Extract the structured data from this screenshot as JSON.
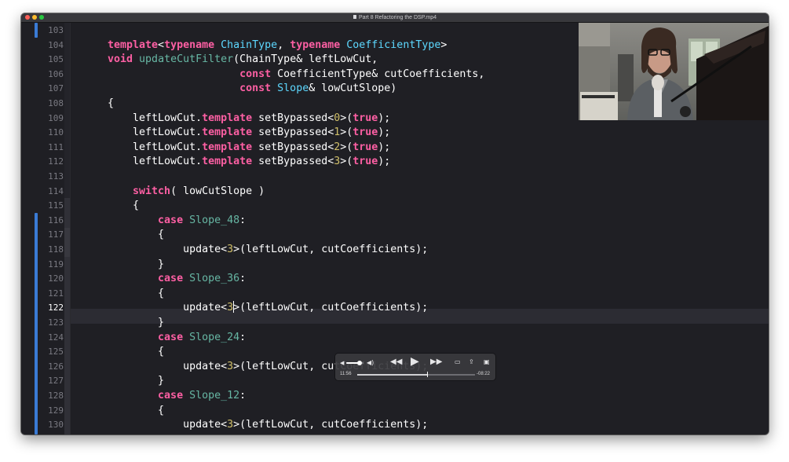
{
  "window": {
    "title": "Part 8 Refactoring the DSP.mp4"
  },
  "editor": {
    "current_line": 122,
    "lines": [
      {
        "num": "103",
        "tokens": []
      },
      {
        "num": "104",
        "tokens": [
          {
            "c": "kw",
            "t": "template"
          },
          {
            "c": "",
            "t": "<"
          },
          {
            "c": "kw",
            "t": "typename"
          },
          {
            "c": "",
            "t": " "
          },
          {
            "c": "ty",
            "t": "ChainType"
          },
          {
            "c": "",
            "t": ", "
          },
          {
            "c": "kw",
            "t": "typename"
          },
          {
            "c": "",
            "t": " "
          },
          {
            "c": "ty",
            "t": "CoefficientType"
          },
          {
            "c": "",
            "t": ">"
          }
        ]
      },
      {
        "num": "105",
        "tokens": [
          {
            "c": "kw",
            "t": "void"
          },
          {
            "c": "",
            "t": " "
          },
          {
            "c": "fn",
            "t": "updateCutFilter"
          },
          {
            "c": "",
            "t": "(ChainType& leftLowCut,"
          }
        ]
      },
      {
        "num": "106",
        "tokens": [
          {
            "c": "",
            "t": "                     "
          },
          {
            "c": "kw",
            "t": "const"
          },
          {
            "c": "",
            "t": " CoefficientType& cutCoefficients,"
          }
        ]
      },
      {
        "num": "107",
        "tokens": [
          {
            "c": "",
            "t": "                     "
          },
          {
            "c": "kw",
            "t": "const"
          },
          {
            "c": "",
            "t": " "
          },
          {
            "c": "ty",
            "t": "Slope"
          },
          {
            "c": "",
            "t": "& lowCutSlope)"
          }
        ]
      },
      {
        "num": "108",
        "tokens": [
          {
            "c": "",
            "t": "{"
          }
        ]
      },
      {
        "num": "109",
        "tokens": [
          {
            "c": "",
            "t": "    leftLowCut."
          },
          {
            "c": "kw",
            "t": "template"
          },
          {
            "c": "",
            "t": " setBypassed<"
          },
          {
            "c": "num",
            "t": "0"
          },
          {
            "c": "",
            "t": ">("
          },
          {
            "c": "kw",
            "t": "true"
          },
          {
            "c": "",
            "t": ");"
          }
        ]
      },
      {
        "num": "110",
        "tokens": [
          {
            "c": "",
            "t": "    leftLowCut."
          },
          {
            "c": "kw",
            "t": "template"
          },
          {
            "c": "",
            "t": " setBypassed<"
          },
          {
            "c": "num",
            "t": "1"
          },
          {
            "c": "",
            "t": ">("
          },
          {
            "c": "kw",
            "t": "true"
          },
          {
            "c": "",
            "t": ");"
          }
        ]
      },
      {
        "num": "111",
        "tokens": [
          {
            "c": "",
            "t": "    leftLowCut."
          },
          {
            "c": "kw",
            "t": "template"
          },
          {
            "c": "",
            "t": " setBypassed<"
          },
          {
            "c": "num",
            "t": "2"
          },
          {
            "c": "",
            "t": ">("
          },
          {
            "c": "kw",
            "t": "true"
          },
          {
            "c": "",
            "t": ");"
          }
        ]
      },
      {
        "num": "112",
        "tokens": [
          {
            "c": "",
            "t": "    leftLowCut."
          },
          {
            "c": "kw",
            "t": "template"
          },
          {
            "c": "",
            "t": " setBypassed<"
          },
          {
            "c": "num",
            "t": "3"
          },
          {
            "c": "",
            "t": ">("
          },
          {
            "c": "kw",
            "t": "true"
          },
          {
            "c": "",
            "t": ");"
          }
        ]
      },
      {
        "num": "113",
        "tokens": []
      },
      {
        "num": "114",
        "tokens": [
          {
            "c": "",
            "t": "    "
          },
          {
            "c": "kw",
            "t": "switch"
          },
          {
            "c": "",
            "t": "( lowCutSlope )"
          }
        ]
      },
      {
        "num": "115",
        "tokens": [
          {
            "c": "",
            "t": "    {"
          }
        ]
      },
      {
        "num": "116",
        "tokens": [
          {
            "c": "",
            "t": "        "
          },
          {
            "c": "kw",
            "t": "case"
          },
          {
            "c": "",
            "t": " "
          },
          {
            "c": "fn",
            "t": "Slope_48"
          },
          {
            "c": "",
            "t": ":"
          }
        ]
      },
      {
        "num": "117",
        "tokens": [
          {
            "c": "",
            "t": "        {"
          }
        ]
      },
      {
        "num": "118",
        "tokens": [
          {
            "c": "",
            "t": "            update<"
          },
          {
            "c": "num",
            "t": "3"
          },
          {
            "c": "",
            "t": ">(leftLowCut, cutCoefficients);"
          }
        ]
      },
      {
        "num": "119",
        "tokens": [
          {
            "c": "",
            "t": "        }"
          }
        ]
      },
      {
        "num": "120",
        "tokens": [
          {
            "c": "",
            "t": "        "
          },
          {
            "c": "kw",
            "t": "case"
          },
          {
            "c": "",
            "t": " "
          },
          {
            "c": "fn",
            "t": "Slope_36"
          },
          {
            "c": "",
            "t": ":"
          }
        ]
      },
      {
        "num": "121",
        "tokens": [
          {
            "c": "",
            "t": "        {"
          }
        ]
      },
      {
        "num": "122",
        "cursor_after": 1,
        "tokens": [
          {
            "c": "",
            "t": "            update<"
          },
          {
            "c": "num",
            "t": "3"
          },
          {
            "c": "",
            "t": ">(leftLowCut, cutCoefficients);"
          }
        ]
      },
      {
        "num": "123",
        "tokens": [
          {
            "c": "",
            "t": "        }"
          }
        ]
      },
      {
        "num": "124",
        "tokens": [
          {
            "c": "",
            "t": "        "
          },
          {
            "c": "kw",
            "t": "case"
          },
          {
            "c": "",
            "t": " "
          },
          {
            "c": "fn",
            "t": "Slope_24"
          },
          {
            "c": "",
            "t": ":"
          }
        ]
      },
      {
        "num": "125",
        "tokens": [
          {
            "c": "",
            "t": "        {"
          }
        ]
      },
      {
        "num": "126",
        "tokens": [
          {
            "c": "",
            "t": "            update<"
          },
          {
            "c": "num",
            "t": "3"
          },
          {
            "c": "",
            "t": ">(leftLowCut, cutCoefficients);"
          }
        ]
      },
      {
        "num": "127",
        "tokens": [
          {
            "c": "",
            "t": "        }"
          }
        ]
      },
      {
        "num": "128",
        "tokens": [
          {
            "c": "",
            "t": "        "
          },
          {
            "c": "kw",
            "t": "case"
          },
          {
            "c": "",
            "t": " "
          },
          {
            "c": "fn",
            "t": "Slope_12"
          },
          {
            "c": "",
            "t": ":"
          }
        ]
      },
      {
        "num": "129",
        "tokens": [
          {
            "c": "",
            "t": "        {"
          }
        ]
      },
      {
        "num": "130",
        "tokens": [
          {
            "c": "",
            "t": "            update<"
          },
          {
            "c": "num",
            "t": "3"
          },
          {
            "c": "",
            "t": ">(leftLowCut, cutCoefficients);"
          }
        ]
      }
    ]
  },
  "player": {
    "elapsed": "11:56",
    "remaining": "-08:22",
    "progress": 0.59,
    "volume": 0.75,
    "icons": {
      "volume_low": "speaker-low-icon",
      "volume_high": "speaker-high-icon",
      "rewind": "rewind-icon",
      "play": "play-icon",
      "fast_forward": "fast-forward-icon",
      "airplay": "airplay-icon",
      "share": "share-icon",
      "pip": "picture-in-picture-icon"
    }
  },
  "colors": {
    "keyword": "#fc5fa3",
    "type": "#5dd8ff",
    "function": "#67b7a4",
    "number": "#d0bf69",
    "change_bar": "#3a7bd5"
  }
}
